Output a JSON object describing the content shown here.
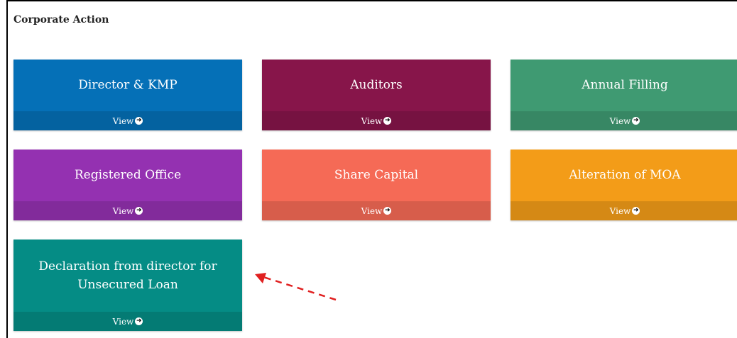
{
  "section": {
    "title": "Corporate Action"
  },
  "cards": [
    {
      "label": "Director & KMP",
      "view": "View",
      "color": "#0570b7"
    },
    {
      "label": "Auditors",
      "view": "View",
      "color": "#87154a"
    },
    {
      "label": "Annual Filling",
      "view": "View",
      "color": "#3f9a72"
    },
    {
      "label": "Registered Office",
      "view": "View",
      "color": "#9431b1"
    },
    {
      "label": "Share Capital",
      "view": "View",
      "color": "#f56a56"
    },
    {
      "label": "Alteration of MOA",
      "view": "View",
      "color": "#f39c18"
    },
    {
      "label": "Declaration from director for Unsecured Loan",
      "view": "View",
      "color": "#058c85"
    }
  ],
  "annotation": {
    "arrow_color": "#e02020",
    "icon": "dashed-arrow-icon"
  }
}
